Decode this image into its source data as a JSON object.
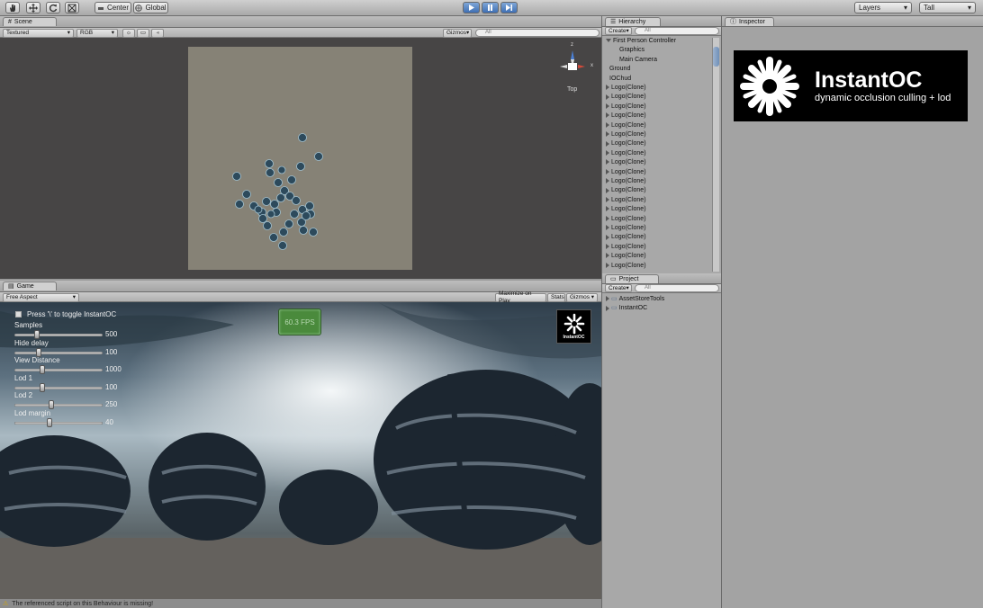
{
  "toolbar": {
    "pivot_label": "Center",
    "space_label": "Global",
    "layers_label": "Layers",
    "layout_label": "Tall"
  },
  "scene": {
    "tab_label": "Scene",
    "shading": "Textured",
    "render_mode": "RGB",
    "gizmos_label": "Gizmos",
    "search_placeholder": "All",
    "view_label": "Top",
    "axis_labels": {
      "x": "x",
      "z": "z"
    }
  },
  "game": {
    "tab_label": "Game",
    "aspect": "Free Aspect",
    "maximize_label": "Maximize on Play",
    "stats_label": "Stats",
    "gizmos_label": "Gizmos",
    "hint": "Press '\\' to toggle InstantOC",
    "fps": "60.3 FPS",
    "sliders": [
      {
        "label": "Samples",
        "value": "500",
        "fraction": 0.25
      },
      {
        "label": "Hide delay",
        "value": "100",
        "fraction": 0.28
      },
      {
        "label": "View Distance",
        "value": "1000",
        "fraction": 0.32
      },
      {
        "label": "Lod 1",
        "value": "100",
        "fraction": 0.32
      },
      {
        "label": "Lod 2",
        "value": "250",
        "fraction": 0.42
      },
      {
        "label": "Lod margin",
        "value": "40",
        "fraction": 0.4
      }
    ],
    "logo_text": "InstantOC"
  },
  "hierarchy": {
    "tab_label": "Hierarchy",
    "create_label": "Create",
    "search_placeholder": "All",
    "items": [
      {
        "label": "First Person Controller",
        "indent": 0,
        "expander": "open"
      },
      {
        "label": "Graphics",
        "indent": 1,
        "expander": "none"
      },
      {
        "label": "Main Camera",
        "indent": 1,
        "expander": "none"
      },
      {
        "label": "Ground",
        "indent": 0,
        "expander": "none"
      },
      {
        "label": "IOChud",
        "indent": 0,
        "expander": "none"
      },
      {
        "label": "Logo(Clone)",
        "indent": 0,
        "expander": "closed"
      },
      {
        "label": "Logo(Clone)",
        "indent": 0,
        "expander": "closed"
      },
      {
        "label": "Logo(Clone)",
        "indent": 0,
        "expander": "closed"
      },
      {
        "label": "Logo(Clone)",
        "indent": 0,
        "expander": "closed"
      },
      {
        "label": "Logo(Clone)",
        "indent": 0,
        "expander": "closed"
      },
      {
        "label": "Logo(Clone)",
        "indent": 0,
        "expander": "closed"
      },
      {
        "label": "Logo(Clone)",
        "indent": 0,
        "expander": "closed"
      },
      {
        "label": "Logo(Clone)",
        "indent": 0,
        "expander": "closed"
      },
      {
        "label": "Logo(Clone)",
        "indent": 0,
        "expander": "closed"
      },
      {
        "label": "Logo(Clone)",
        "indent": 0,
        "expander": "closed"
      },
      {
        "label": "Logo(Clone)",
        "indent": 0,
        "expander": "closed"
      },
      {
        "label": "Logo(Clone)",
        "indent": 0,
        "expander": "closed"
      },
      {
        "label": "Logo(Clone)",
        "indent": 0,
        "expander": "closed"
      },
      {
        "label": "Logo(Clone)",
        "indent": 0,
        "expander": "closed"
      },
      {
        "label": "Logo(Clone)",
        "indent": 0,
        "expander": "closed"
      },
      {
        "label": "Logo(Clone)",
        "indent": 0,
        "expander": "closed"
      },
      {
        "label": "Logo(Clone)",
        "indent": 0,
        "expander": "closed"
      },
      {
        "label": "Logo(Clone)",
        "indent": 0,
        "expander": "closed"
      },
      {
        "label": "Logo(Clone)",
        "indent": 0,
        "expander": "closed"
      },
      {
        "label": "Logo(Clone)",
        "indent": 0,
        "expander": "closed"
      },
      {
        "label": "Logo(Clone)",
        "indent": 0,
        "expander": "closed"
      },
      {
        "label": "Logo(Clone)",
        "indent": 0,
        "expander": "closed"
      },
      {
        "label": "Logo(Clone)",
        "indent": 0,
        "expander": "closed"
      },
      {
        "label": "Logo(Clone)",
        "indent": 0,
        "expander": "closed"
      },
      {
        "label": "Logo(Clone)",
        "indent": 0,
        "expander": "closed"
      },
      {
        "label": "Logo(Clone)",
        "indent": 0,
        "expander": "closed"
      },
      {
        "label": "Logo(Clone)",
        "indent": 0,
        "expander": "closed"
      }
    ]
  },
  "project": {
    "tab_label": "Project",
    "create_label": "Create",
    "search_placeholder": "All",
    "folders": [
      "AssetStoreTools",
      "InstantOC"
    ]
  },
  "inspector": {
    "tab_label": "Inspector",
    "banner_title": "InstantOC",
    "banner_subtitle": "dynamic occlusion culling + lod"
  },
  "status": {
    "message": "The referenced script on this Behaviour is missing!"
  },
  "colors": {
    "accent": "#3f6fb3",
    "fps_green": "#4a8a3c",
    "panel_gray": "#9a9a9a"
  }
}
